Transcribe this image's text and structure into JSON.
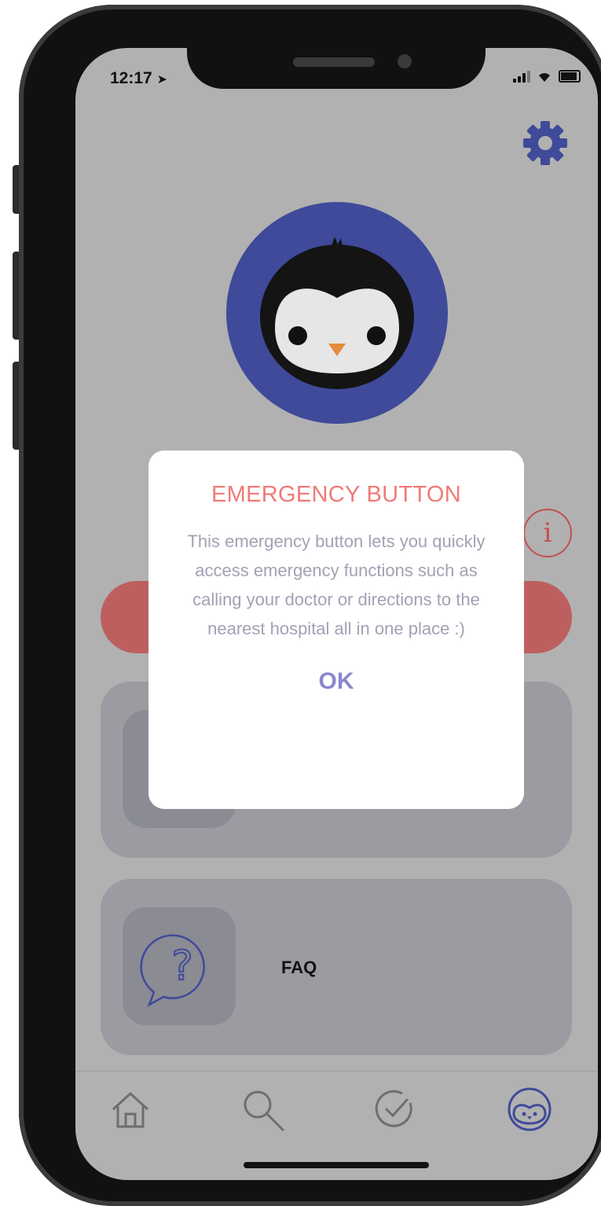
{
  "status_bar": {
    "time": "12:17",
    "location_arrow": "location-arrow-icon"
  },
  "header": {
    "settings_icon": "gear-icon"
  },
  "profile": {
    "avatar_icon": "penguin-avatar-icon"
  },
  "cards": [
    {
      "label": "",
      "icon": "hidden-icon"
    },
    {
      "label": "FAQ",
      "icon": "question-bubble-icon"
    }
  ],
  "dialog": {
    "title": "EMERGENCY BUTTON",
    "body": "This emergency button lets you quickly access emergency functions such as calling your doctor or directions to the nearest hospital all in one place :)",
    "ok_label": "OK"
  },
  "tab_bar": {
    "items": [
      {
        "icon": "home-icon"
      },
      {
        "icon": "search-icon"
      },
      {
        "icon": "check-circle-icon"
      },
      {
        "icon": "penguin-tab-icon",
        "active": true
      }
    ]
  },
  "colors": {
    "overlay_background": "#b1b1b1",
    "accent_blue": "#3f4a9a",
    "emergency_red": "#bd5f5f",
    "dialog_title": "#ef7b78",
    "dialog_ok": "#8c86cf",
    "info_icon": "#c0504e"
  }
}
